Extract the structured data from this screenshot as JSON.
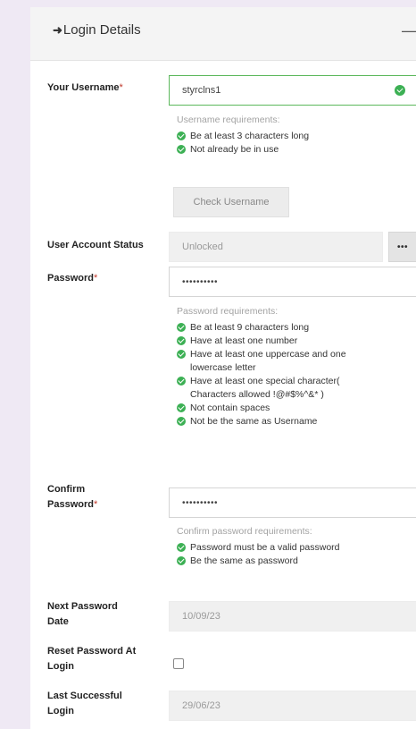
{
  "header": {
    "title": "Login Details",
    "icon": "sign-in-icon",
    "collapse_icon": "minus-icon"
  },
  "username": {
    "label": "Your Username",
    "required_marker": "*",
    "value": "styrclns1",
    "status_icon": "check-circle-icon",
    "requirements_title": "Username requirements:",
    "requirements": [
      "Be at least 3 characters long",
      "Not already be in use"
    ],
    "check_button": "Check Username"
  },
  "account_status": {
    "label": "User Account Status",
    "value": "Unlocked",
    "menu_button": "•••"
  },
  "password": {
    "label": "Password",
    "required_marker": "*",
    "value": "••••••••••",
    "requirements_title": "Password requirements:",
    "requirements": [
      "Be at least 9 characters long",
      "Have at least one number",
      "Have at least one uppercase and one",
      "lowercase letter",
      "Have at least one special character(",
      "Characters allowed !@#$%^&* )",
      "Not contain spaces",
      "Not be the same as Username"
    ]
  },
  "confirm_password": {
    "label_line1": "Confirm",
    "label_line2": "Password",
    "required_marker": "*",
    "value": "••••••••••",
    "requirements_title": "Confirm password requirements:",
    "requirements": [
      "Password must be a valid password",
      "Be the same as password"
    ]
  },
  "next_password_date": {
    "label_line1": "Next Password",
    "label_line2": "Date",
    "value": "10/09/23"
  },
  "reset_password": {
    "label_line1": "Reset Password At",
    "label_line2": "Login",
    "checked": false
  },
  "last_login": {
    "label_line1": "Last Successful",
    "label_line2": "Login",
    "value": "29/06/23"
  },
  "colors": {
    "valid_green": "#3cb054",
    "required_red": "#c0392b",
    "page_background": "#efe9f4"
  }
}
